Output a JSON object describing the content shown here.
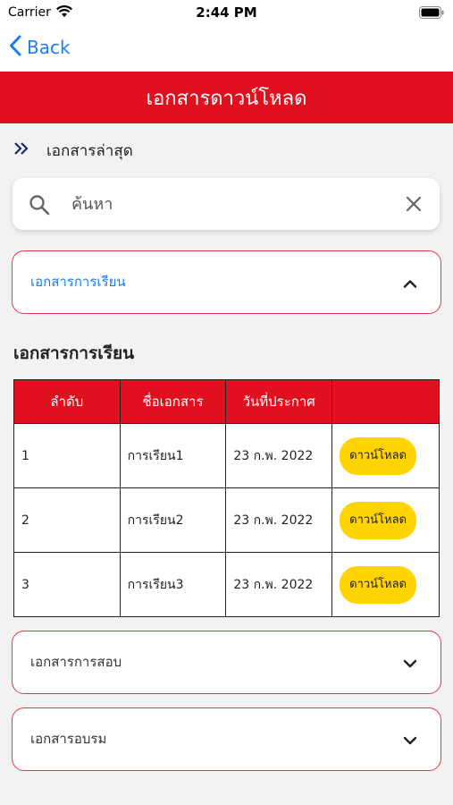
{
  "status_bar": {
    "carrier": "Carrier",
    "time": "2:44 PM"
  },
  "nav": {
    "back_label": "Back"
  },
  "header": {
    "title": "เอกสารดาวน์โหลด"
  },
  "section": {
    "label": "เอกสารล่าสุด"
  },
  "search": {
    "placeholder": "ค้นหา",
    "value": ""
  },
  "accordions": [
    {
      "label": "เอกสารการเรียน",
      "expanded": true
    },
    {
      "label": "เอกสารการสอบ",
      "expanded": false
    },
    {
      "label": "เอกสารอบรม",
      "expanded": false
    }
  ],
  "table": {
    "heading": "เอกสารการเรียน",
    "columns": [
      "ลำดับ",
      "ชื่อเอกสาร",
      "วันที่ประกาศ",
      ""
    ],
    "download_label": "ดาวน์โหลด",
    "rows": [
      {
        "no": "1",
        "name": "การเรียน1",
        "date": "23 ก.พ. 2022"
      },
      {
        "no": "2",
        "name": "การเรียน2",
        "date": "23 ก.พ. 2022"
      },
      {
        "no": "3",
        "name": "การเรียน3",
        "date": "23 ก.พ. 2022"
      }
    ]
  },
  "colors": {
    "accent_red": "#e0101e",
    "link_blue": "#1a7df0",
    "download_yellow": "#ffd400"
  }
}
